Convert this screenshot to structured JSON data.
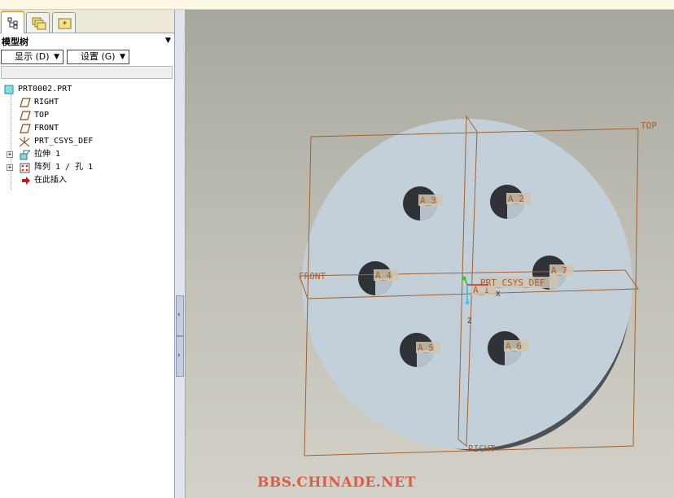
{
  "panel": {
    "title": "模型树",
    "show_button": "显示 (D)",
    "settings_button": "设置 (G)"
  },
  "tabs": [
    {
      "icon": "model-tree-icon",
      "active": true
    },
    {
      "icon": "layers-icon",
      "active": false
    },
    {
      "icon": "favorites-icon",
      "active": false
    }
  ],
  "tree": {
    "root": "PRT0002.PRT",
    "items": [
      {
        "label": "RIGHT",
        "icon": "datum-plane-icon"
      },
      {
        "label": "TOP",
        "icon": "datum-plane-icon"
      },
      {
        "label": "FRONT",
        "icon": "datum-plane-icon"
      },
      {
        "label": "PRT_CSYS_DEF",
        "icon": "csys-icon"
      },
      {
        "label": "拉伸 1",
        "icon": "extrude-icon"
      },
      {
        "label": "阵列 1 / 孔 1",
        "icon": "pattern-icon"
      },
      {
        "label": "在此插入",
        "icon": "insert-here-icon"
      }
    ]
  },
  "viewport": {
    "plane_labels": {
      "top": "TOP",
      "front": "FRONT",
      "right": "RIGHT"
    },
    "csys_label": "PRT_CSYS_DEF",
    "axis_labels": [
      "A_1",
      "A_2",
      "A_3",
      "A_4",
      "A_5",
      "A_6",
      "A_7"
    ],
    "axis_x": "X",
    "axis_z": "Z",
    "colors": {
      "datum": "#a4612e",
      "part_face": "#c3d0da",
      "part_side": "#4c5258",
      "hole": "#2f3338",
      "label_box": "#d0c4b0"
    }
  },
  "watermark": "BBS.CHINADE.NET"
}
